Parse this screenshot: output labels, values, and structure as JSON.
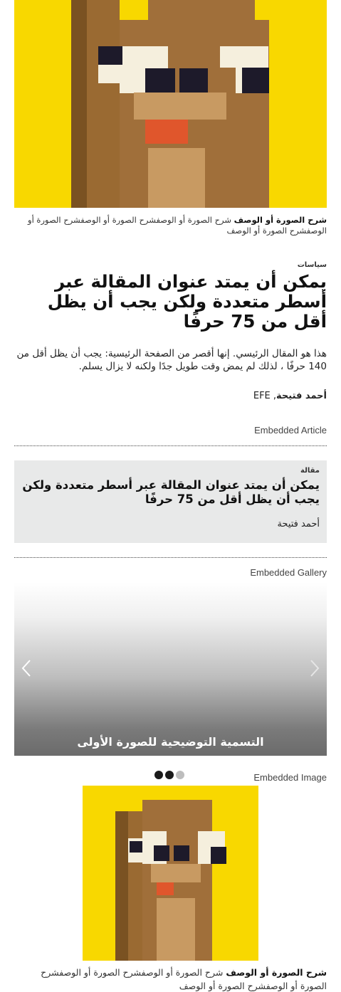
{
  "hero_image": {
    "alt_icon": "pixel-dog-icon"
  },
  "hero_caption": {
    "bold": "شرح الصورة أو الوصف",
    "text": " شرح الصورة أو الوصفشرح الصورة أو الوصفشرح الصورة أو الوصفشرح الصورة أو الوصف"
  },
  "article": {
    "section": "سياسات",
    "headline": "يمكن أن يمتد عنوان المقالة عبر أسطر متعددة ولكن يجب أن يظل أقل من 75 حرفًا",
    "dek": "هذا هو المقال الرئيسي. إنها أقصر من الصفحة الرئيسية: يجب أن يظل أقل من 140 حرفًا ، لذلك لم يمض وقت طويل جدًا ولكنه لا يزال يسلم.",
    "author": "أحمد فتيحة",
    "agency": ", EFE"
  },
  "embedded_article": {
    "label": "Embedded Article",
    "section": "مقالة",
    "title": "يمكن أن يمتد عنوان المقالة عبر أسطر متعددة ولكن يجب أن يظل أقل من 75 حرفًا",
    "author": "أحمد فتيحة"
  },
  "embedded_gallery": {
    "label": "Embedded Gallery",
    "caption": "التسمية التوضيحية للصورة الأولى",
    "dots": [
      {
        "state": "active"
      },
      {
        "state": "active"
      },
      {
        "state": "inactive"
      }
    ]
  },
  "embedded_image": {
    "label": "Embedded Image",
    "caption_bold": "شرح الصورة أو الوصف",
    "caption_text": " شرح الصورة أو الوصفشرح الصورة أو الوصفشرح الصورة أو الوصفشرح الصورة أو الوصف"
  },
  "colors": {
    "image_bg": "#f8d800",
    "card_bg": "#e8e9e9"
  }
}
